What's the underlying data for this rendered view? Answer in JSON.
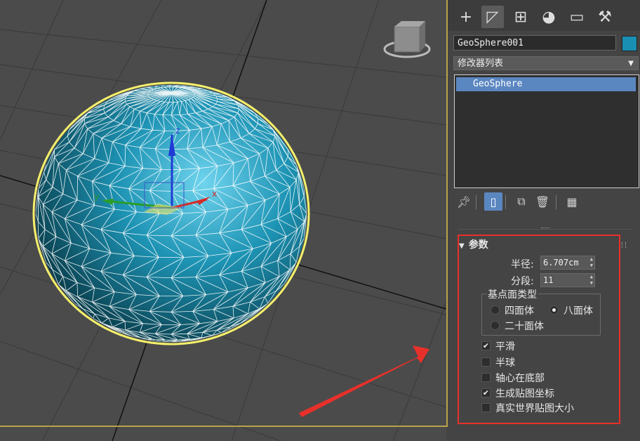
{
  "colors": {
    "object_color": "#1a8fb4",
    "selection_highlight": "#5b87c1",
    "annotation_red": "#e8302a",
    "viewport_border": "#b9a34a"
  },
  "command_panel": {
    "tabs": [
      {
        "icon": "plus-icon",
        "glyph": "+"
      },
      {
        "icon": "modify-icon",
        "glyph": "◸"
      },
      {
        "icon": "hierarchy-icon",
        "glyph": "⊞"
      },
      {
        "icon": "motion-icon",
        "glyph": "◕"
      },
      {
        "icon": "display-icon",
        "glyph": "▭"
      },
      {
        "icon": "utilities-icon",
        "glyph": "⚒"
      }
    ],
    "object_name": "GeoSphere001",
    "modifier_list_label": "修改器列表",
    "stack_items": [
      "GeoSphere"
    ]
  },
  "parameters": {
    "title": "参数",
    "radius_label": "半径:",
    "radius_value": "6.707cm",
    "segments_label": "分段:",
    "segments_value": "11",
    "base_type_group": "基点面类型",
    "base_types": [
      {
        "label": "四面体",
        "checked": false
      },
      {
        "label": "八面体",
        "checked": true
      },
      {
        "label": "二十面体",
        "checked": false
      }
    ],
    "options": [
      {
        "label": "平滑",
        "checked": true
      },
      {
        "label": "半球",
        "checked": false
      },
      {
        "label": "轴心在底部",
        "checked": false
      },
      {
        "label": "生成贴图坐标",
        "checked": true
      },
      {
        "label": "真实世界贴图大小",
        "checked": false
      }
    ]
  },
  "gizmo_labels": {
    "z": "z",
    "x": "x",
    "y": "y"
  }
}
